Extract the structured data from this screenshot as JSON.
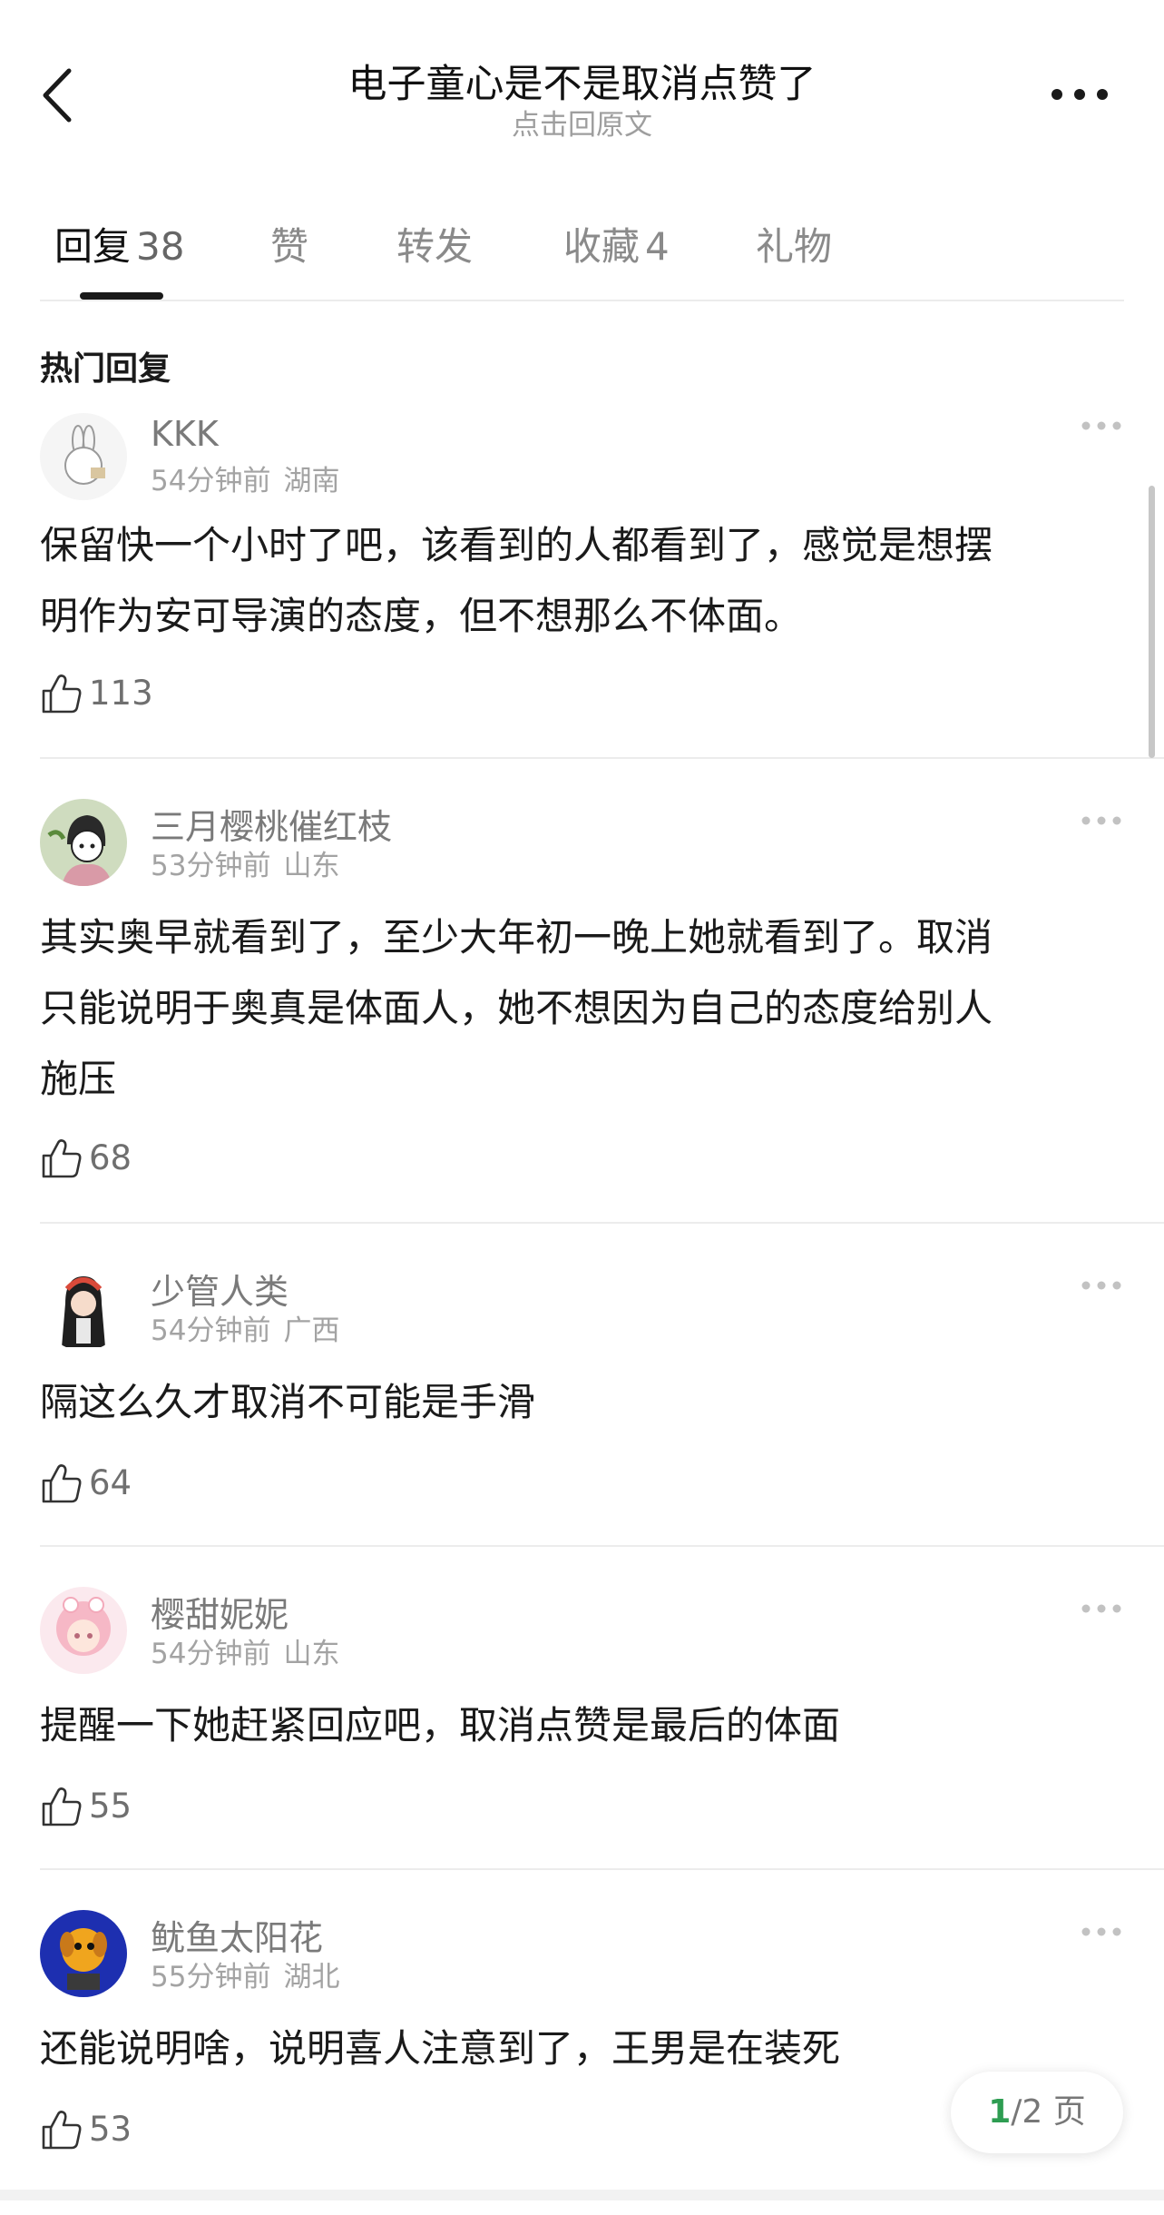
{
  "header": {
    "title": "电子童心是不是取消点赞了",
    "subtitle": "点击回原文"
  },
  "tabs": [
    {
      "label": "回复",
      "count": "38",
      "active": true
    },
    {
      "label": "赞",
      "count": ""
    },
    {
      "label": "转发",
      "count": ""
    },
    {
      "label": "收藏",
      "count": "4"
    },
    {
      "label": "礼物",
      "count": ""
    }
  ],
  "section_title": "热门回复",
  "comments": [
    {
      "username": "KKK",
      "time": "54分钟前",
      "location": "湖南",
      "lines": [
        "保留快一个小时了吧，该看到的人都看到了，感觉是想摆",
        "明作为安可导演的态度，但不想那么不体面。"
      ],
      "likes": "113"
    },
    {
      "username": "三月樱桃催红枝",
      "time": "53分钟前",
      "location": "山东",
      "lines": [
        "其实奥早就看到了，至少大年初一晚上她就看到了。取消",
        "只能说明于奥真是体面人，她不想因为自己的态度给别人",
        "施压"
      ],
      "likes": "68"
    },
    {
      "username": "少管人类",
      "time": "54分钟前",
      "location": "广西",
      "lines": [
        "隔这么久才取消不可能是手滑"
      ],
      "likes": "64"
    },
    {
      "username": "樱甜妮妮",
      "time": "54分钟前",
      "location": "山东",
      "lines": [
        "提醒一下她赶紧回应吧，取消点赞是最后的体面"
      ],
      "likes": "55"
    },
    {
      "username": "鱿鱼太阳花",
      "time": "55分钟前",
      "location": "湖北",
      "lines": [
        "还能说明啥，说明喜人注意到了，王男是在装死"
      ],
      "likes": "53"
    }
  ],
  "pager": {
    "current": "1",
    "total_text": "/2 页"
  },
  "colors": {
    "accent_green": "#2e9d52",
    "text_primary": "#1a1a1a",
    "text_secondary": "#7a7a7a",
    "divider": "#ececec"
  }
}
